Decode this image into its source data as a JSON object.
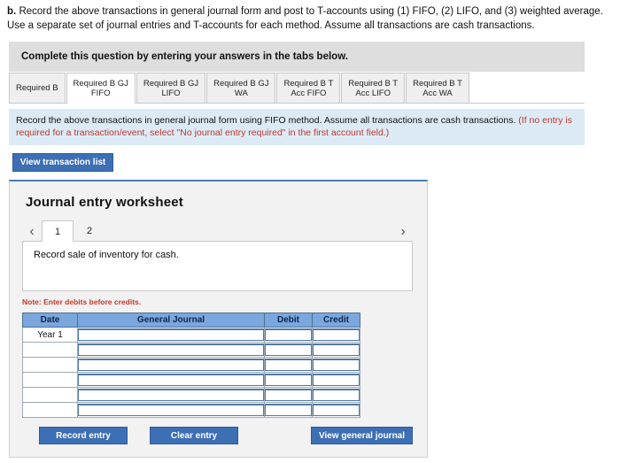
{
  "prompt": {
    "label": "b.",
    "text": "Record the above transactions in general journal form and post to T-accounts using (1) FIFO, (2) LIFO, and (3) weighted average. Use a separate set of journal entries and T-accounts for each method. Assume all transactions are cash transactions."
  },
  "complete_bar": {
    "text": "Complete this question by entering your answers in the tabs below."
  },
  "tabs": [
    {
      "line1": "Required B",
      "line2": "",
      "active": false
    },
    {
      "line1": "Required B GJ",
      "line2": "FIFO",
      "active": true
    },
    {
      "line1": "Required B GJ",
      "line2": "LIFO",
      "active": false
    },
    {
      "line1": "Required B GJ",
      "line2": "WA",
      "active": false
    },
    {
      "line1": "Required B T",
      "line2": "Acc FIFO",
      "active": false
    },
    {
      "line1": "Required B T",
      "line2": "Acc LIFO",
      "active": false
    },
    {
      "line1": "Required B T",
      "line2": "Acc WA",
      "active": false
    }
  ],
  "instruction": {
    "main": "Record the above transactions in general journal form using FIFO method. Assume all transactions are cash transactions.",
    "red": "(If no entry is required for a transaction/event, select \"No journal entry required\" in the first account field.)"
  },
  "buttons": {
    "view_transaction_list": "View transaction list",
    "record_entry": "Record entry",
    "clear_entry": "Clear entry",
    "view_general_journal": "View general journal"
  },
  "worksheet": {
    "title": "Journal entry worksheet",
    "pager": {
      "prev_icon": "chevron-left",
      "next_icon": "chevron-right",
      "pages": [
        "1",
        "2"
      ],
      "active_page": "1"
    },
    "description": "Record sale of inventory for cash.",
    "note": "Note: Enter debits before credits.",
    "table": {
      "headers": [
        "Date",
        "General Journal",
        "Debit",
        "Credit"
      ],
      "rows": [
        {
          "date": "Year 1",
          "journal": "",
          "debit": "",
          "credit": ""
        },
        {
          "date": "",
          "journal": "",
          "debit": "",
          "credit": ""
        },
        {
          "date": "",
          "journal": "",
          "debit": "",
          "credit": ""
        },
        {
          "date": "",
          "journal": "",
          "debit": "",
          "credit": ""
        },
        {
          "date": "",
          "journal": "",
          "debit": "",
          "credit": ""
        },
        {
          "date": "",
          "journal": "",
          "debit": "",
          "credit": ""
        }
      ]
    }
  },
  "colors": {
    "button_blue": "#3d6fb5",
    "table_header_blue": "#7aa7dd",
    "instruction_blue": "#dceaf6",
    "complete_gray": "#dedede",
    "panel_gray": "#f2f2f2",
    "red_text": "#c0392b"
  }
}
